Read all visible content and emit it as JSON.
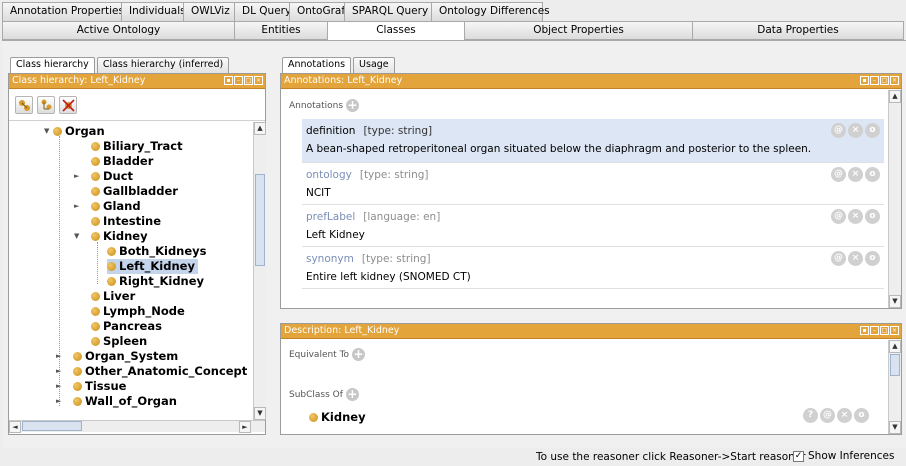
{
  "top_tabs": [
    "Annotation Properties",
    "Individuals",
    "OWLViz",
    "DL Query",
    "OntoGraf",
    "SPARQL Query",
    "Ontology Differences"
  ],
  "sub_tabs": [
    "Active Ontology",
    "Entities",
    "Classes",
    "Object Properties",
    "Data Properties"
  ],
  "left": {
    "tabs": [
      "Class hierarchy",
      "Class hierarchy (inferred)"
    ],
    "header": "Class hierarchy: Left_Kidney",
    "tree": {
      "organ": "Organ",
      "biliary_tract": "Biliary_Tract",
      "bladder": "Bladder",
      "duct": "Duct",
      "gallbladder": "Gallbladder",
      "gland": "Gland",
      "intestine": "Intestine",
      "kidney": "Kidney",
      "both_kidneys": "Both_Kidneys",
      "left_kidney": "Left_Kidney",
      "right_kidney": "Right_Kidney",
      "liver": "Liver",
      "lymph_node": "Lymph_Node",
      "pancreas": "Pancreas",
      "spleen": "Spleen",
      "organ_system": "Organ_System",
      "other_anatomic_concept": "Other_Anatomic_Concept",
      "tissue": "Tissue",
      "wall_of_organ": "Wall_of_Organ"
    }
  },
  "right": {
    "tabs": [
      "Annotations",
      "Usage"
    ],
    "header": "Annotations: Left_Kidney",
    "section_label": "Annotations",
    "annotations": [
      {
        "prop": "definition",
        "type": "[type: string]",
        "value": "A bean-shaped retroperitoneal organ situated below the diaphragm and posterior to the spleen."
      },
      {
        "prop": "ontology",
        "type": "[type: string]",
        "value": "NCIT"
      },
      {
        "prop": "prefLabel",
        "type": "[language: en]",
        "value": "Left Kidney"
      },
      {
        "prop": "synonym",
        "type": "[type: string]",
        "value": "Entire left kidney (SNOMED CT)"
      }
    ]
  },
  "description": {
    "header": "Description: Left_Kidney",
    "equivalent_to": "Equivalent To",
    "subclass_of": "SubClass Of",
    "subclass_value": "Kidney"
  },
  "status": {
    "message": "To use the reasoner click Reasoner->Start reasoner",
    "show_inferences": "Show Inferences"
  },
  "colors": {
    "header": "#e2a43b",
    "selection": "#c4d4ea"
  }
}
